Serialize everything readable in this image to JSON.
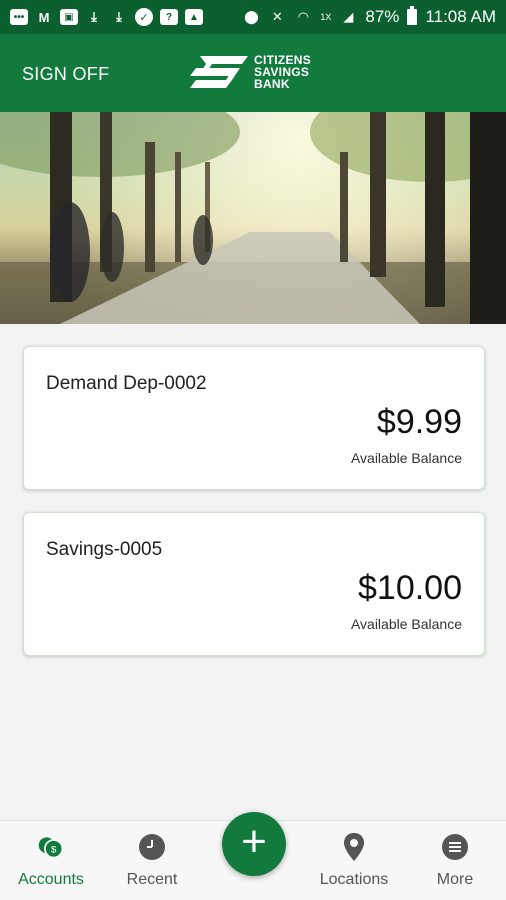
{
  "status_bar": {
    "battery": "87%",
    "time": "11:08 AM",
    "network": "1X"
  },
  "header": {
    "sign_off": "SIGN OFF",
    "logo_lines": [
      "CITIZENS",
      "SAVINGS",
      "BANK"
    ]
  },
  "accounts": [
    {
      "name": "Demand Dep-0002",
      "balance": "$9.99",
      "balance_label": "Available Balance"
    },
    {
      "name": "Savings-0005",
      "balance": "$10.00",
      "balance_label": "Available Balance"
    }
  ],
  "nav": {
    "accounts": "Accounts",
    "recent": "Recent",
    "add": "+",
    "locations": "Locations",
    "more": "More"
  },
  "colors": {
    "status_bar": "#0c5f2e",
    "brand": "#137a3e"
  }
}
